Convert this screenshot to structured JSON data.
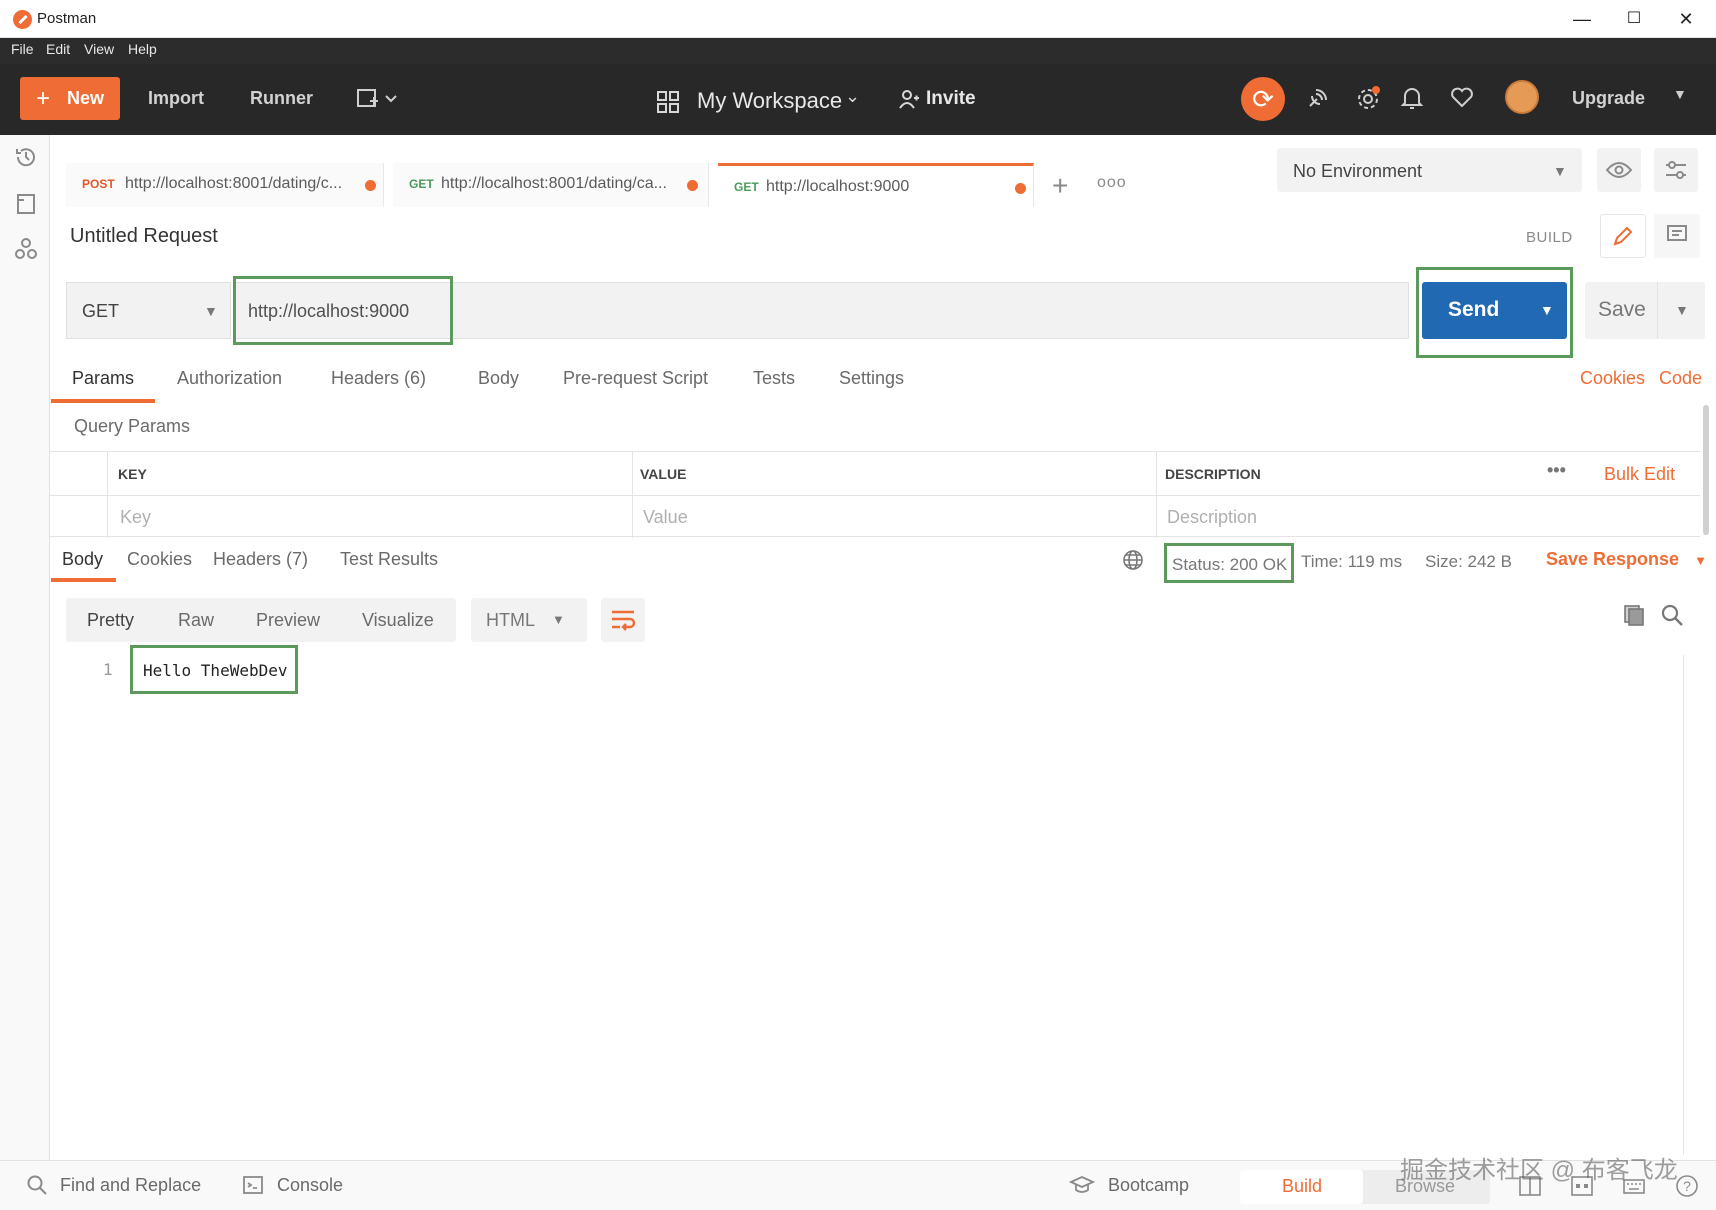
{
  "window": {
    "title": "Postman",
    "controls": {
      "minimize": "—",
      "maximize": "☐",
      "close": "✕"
    }
  },
  "menu": [
    "File",
    "Edit",
    "View",
    "Help"
  ],
  "header": {
    "new_label": "New",
    "import_label": "Import",
    "runner_label": "Runner",
    "workspace_label": "My Workspace",
    "invite_label": "Invite",
    "upgrade_label": "Upgrade",
    "accent": "#ef6c35"
  },
  "tabs": [
    {
      "method": "POST",
      "url": "http://localhost:8001/dating/c...",
      "method_color": "#e2562a"
    },
    {
      "method": "GET",
      "url": "http://localhost:8001/dating/ca...",
      "method_color": "#4a9a5a"
    },
    {
      "method": "GET",
      "url": "http://localhost:9000",
      "method_color": "#4a9a5a"
    }
  ],
  "environment": {
    "selected": "No Environment"
  },
  "request": {
    "name": "Untitled Request",
    "build_label": "BUILD",
    "method": "GET",
    "url": "http://localhost:9000",
    "send_label": "Send",
    "save_label": "Save",
    "send_color": "#2169b3"
  },
  "request_tabs": [
    "Params",
    "Authorization",
    "Headers (6)",
    "Body",
    "Pre-request Script",
    "Tests",
    "Settings"
  ],
  "request_links": {
    "cookies": "Cookies",
    "code": "Code"
  },
  "query_params": {
    "title": "Query Params",
    "columns": [
      "KEY",
      "VALUE",
      "DESCRIPTION"
    ],
    "placeholders": [
      "Key",
      "Value",
      "Description"
    ],
    "more": "•••",
    "bulk_edit": "Bulk Edit"
  },
  "response": {
    "tabs": [
      "Body",
      "Cookies",
      "Headers (7)",
      "Test Results"
    ],
    "status": "Status: 200 OK",
    "time": "Time: 119 ms",
    "size": "Size: 242 B",
    "save_response": "Save Response",
    "formats": [
      "Pretty",
      "Raw",
      "Preview",
      "Visualize"
    ],
    "language": "HTML",
    "lines": [
      {
        "number": "1",
        "text": "Hello TheWebDev"
      }
    ]
  },
  "footer": {
    "find_replace": "Find and Replace",
    "console": "Console",
    "bootcamp": "Bootcamp",
    "build": "Build",
    "browse": "Browse"
  },
  "watermark": "掘金技术社区 @ 布客飞龙",
  "icons": {
    "history": "history-icon",
    "collections": "collections-icon",
    "apis": "apis-icon",
    "sync": "sync-icon",
    "satellite": "satellite-icon",
    "settings": "gear-icon",
    "bell": "bell-icon",
    "heart": "heart-icon",
    "eye": "eye-icon",
    "sliders": "sliders-icon",
    "globe": "globe-icon",
    "copy": "copy-icon",
    "search": "search-icon"
  }
}
